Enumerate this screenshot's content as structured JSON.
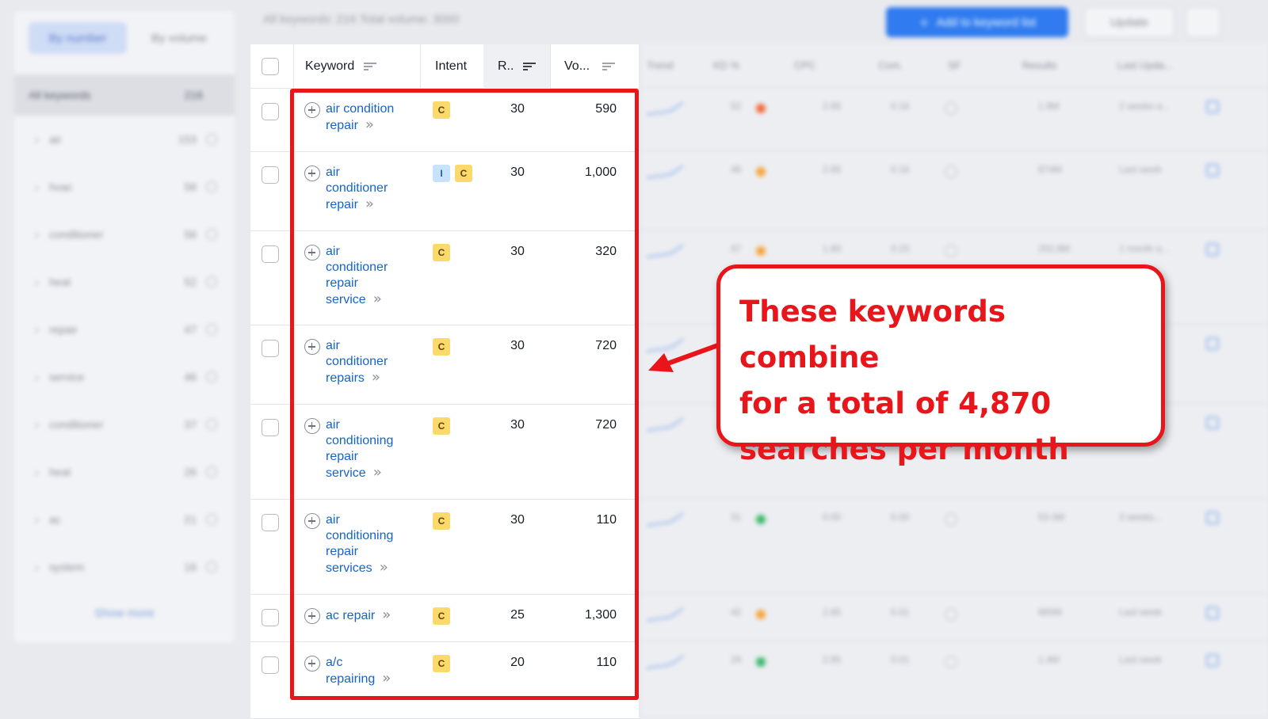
{
  "sidebar": {
    "toggle": [
      "By number",
      "By volume"
    ],
    "all_keywords": {
      "label": "All keywords",
      "count": "216"
    },
    "groups": [
      {
        "name": "air",
        "count": "153"
      },
      {
        "name": "hvac",
        "count": "58"
      },
      {
        "name": "conditioner",
        "count": "56"
      },
      {
        "name": "heat",
        "count": "52"
      },
      {
        "name": "repair",
        "count": "47"
      },
      {
        "name": "service",
        "count": "46"
      },
      {
        "name": "conditioner",
        "count": "37"
      },
      {
        "name": "heat",
        "count": "26"
      },
      {
        "name": "ac",
        "count": "21"
      },
      {
        "name": "system",
        "count": "16"
      }
    ],
    "show_more": "Show more"
  },
  "topbar": {
    "summary": "All keywords: 216   Total volume: 3000",
    "add_button": "Add to keyword list",
    "update_button": "Update",
    "colors": {
      "primary": "#2f7bef"
    }
  },
  "table": {
    "headers": {
      "keyword": "Keyword",
      "intent": "Intent",
      "rank": "R..",
      "volume": "Vo..."
    },
    "bg_headers": [
      "Trend",
      "KD %",
      "CPC",
      "Com.",
      "SF",
      "Results",
      "Last Upda..."
    ],
    "rows": [
      {
        "lines": [
          "air condition",
          "repair"
        ],
        "intent": [
          "C"
        ],
        "rank": "30",
        "volume": "590",
        "bg": {
          "kd": "52",
          "kd_color": "#f26a3b",
          "cpc": "2.85",
          "com": "0.16",
          "results": "1.9M",
          "updated": "2 weeks a..."
        }
      },
      {
        "lines": [
          "air",
          "conditioner",
          "repair"
        ],
        "intent": [
          "I",
          "C"
        ],
        "rank": "30",
        "volume": "1,000",
        "bg": {
          "kd": "48",
          "kd_color": "#f7a33b",
          "cpc": "2.85",
          "com": "0.16",
          "results": "874M",
          "updated": "Last week"
        }
      },
      {
        "lines": [
          "air",
          "conditioner",
          "repair",
          "service"
        ],
        "intent": [
          "C"
        ],
        "rank": "30",
        "volume": "320",
        "bg": {
          "kd": "47",
          "kd_color": "#f7a33b",
          "cpc": "1.80",
          "com": "0.23",
          "results": "202.8M",
          "updated": "1 month a..."
        }
      },
      {
        "lines": [
          "air",
          "conditioner",
          "repairs"
        ],
        "intent": [
          "C"
        ],
        "rank": "30",
        "volume": "720",
        "bg": {
          "kd": "",
          "kd_color": "#f7a33b",
          "cpc": "",
          "com": "",
          "results": "",
          "updated": ""
        }
      },
      {
        "lines": [
          "air",
          "conditioning",
          "repair",
          "service"
        ],
        "intent": [
          "C"
        ],
        "rank": "30",
        "volume": "720",
        "bg": {
          "kd": "",
          "kd_color": "#f7a33b",
          "cpc": "",
          "com": "",
          "results": "",
          "updated": ""
        }
      },
      {
        "lines": [
          "air",
          "conditioning",
          "repair",
          "services"
        ],
        "intent": [
          "C"
        ],
        "rank": "30",
        "volume": "110",
        "bg": {
          "kd": "31",
          "kd_color": "#3bb86b",
          "cpc": "0.00",
          "com": "0.00",
          "results": "53.3M",
          "updated": "3 weeks..."
        }
      },
      {
        "lines": [
          "ac repair"
        ],
        "intent": [
          "C"
        ],
        "rank": "25",
        "volume": "1,300",
        "bg": {
          "kd": "42",
          "kd_color": "#f7a33b",
          "cpc": "2.85",
          "com": "0.01",
          "results": "665M",
          "updated": "Last week"
        }
      },
      {
        "lines": [
          "a/c",
          "repairing"
        ],
        "intent": [
          "C"
        ],
        "rank": "20",
        "volume": "110",
        "bg": {
          "kd": "29",
          "kd_color": "#3bb86b",
          "cpc": "2.85",
          "com": "0.01",
          "results": "1.4M",
          "updated": "Last week"
        }
      }
    ]
  },
  "annotation": {
    "lines": [
      "These keywords combine",
      "for a total of 4,870",
      "searches per month"
    ],
    "color": "#e8161b"
  }
}
